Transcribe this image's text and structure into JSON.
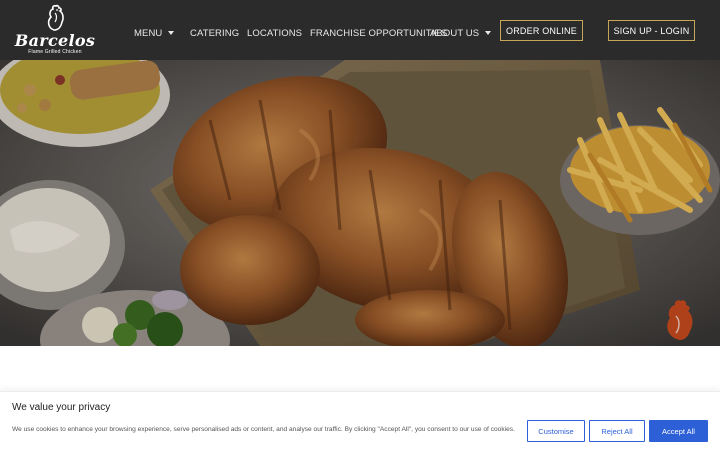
{
  "brand": {
    "name": "Barcelos",
    "tagline": "Flame Grilled Chicken",
    "logo_icon": "rooster-icon"
  },
  "nav": {
    "menu": "MENU",
    "catering": "CATERING",
    "locations": "LOCATIONS",
    "franchise": "FRANCHISE OPPORTUNITIES",
    "about": "ABOUT US",
    "order_online": "ORDER ONLINE",
    "signup_login": "SIGN UP - LOGIN"
  },
  "hero": {
    "image_subject": "flame grilled chicken platter with fries, rice, salad and vegetables",
    "watermark_icon": "rooster-icon"
  },
  "cookie": {
    "title": "We value your privacy",
    "text": "We use cookies to enhance your browsing experience, serve personalised ads or content, and analyse our traffic. By clicking \"Accept All\", you consent to our use of cookies.",
    "customise": "Customise",
    "reject": "Reject All",
    "accept": "Accept All"
  },
  "colors": {
    "header_bg": "#2b2b2b",
    "gold_accent": "#c7a559",
    "cookie_accent": "#2d5fd6"
  }
}
